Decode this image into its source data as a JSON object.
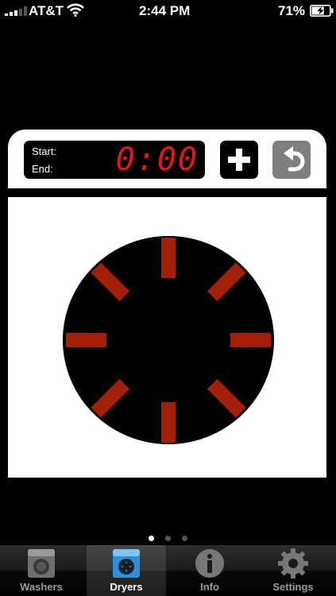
{
  "status_bar": {
    "carrier": "AT&T",
    "time": "2:44 PM",
    "battery_percent": "71%",
    "battery_level": 0.71
  },
  "timer": {
    "start_label": "Start:",
    "end_label": "End:",
    "display": "0:00",
    "digit_color": "#e8141c"
  },
  "controls": {
    "add_icon": "plus-icon",
    "undo_icon": "undo-arrow-icon"
  },
  "dial": {
    "tick_count": 8,
    "tick_color": "#a31f0a",
    "face_color": "#000000"
  },
  "pager": {
    "page_count": 3,
    "current_page": 1
  },
  "tabs": [
    {
      "label": "Washers",
      "icon": "washer-icon",
      "active": false
    },
    {
      "label": "Dryers",
      "icon": "dryer-icon",
      "active": true
    },
    {
      "label": "Info",
      "icon": "info-icon",
      "active": false
    },
    {
      "label": "Settings",
      "icon": "gear-icon",
      "active": false
    }
  ]
}
